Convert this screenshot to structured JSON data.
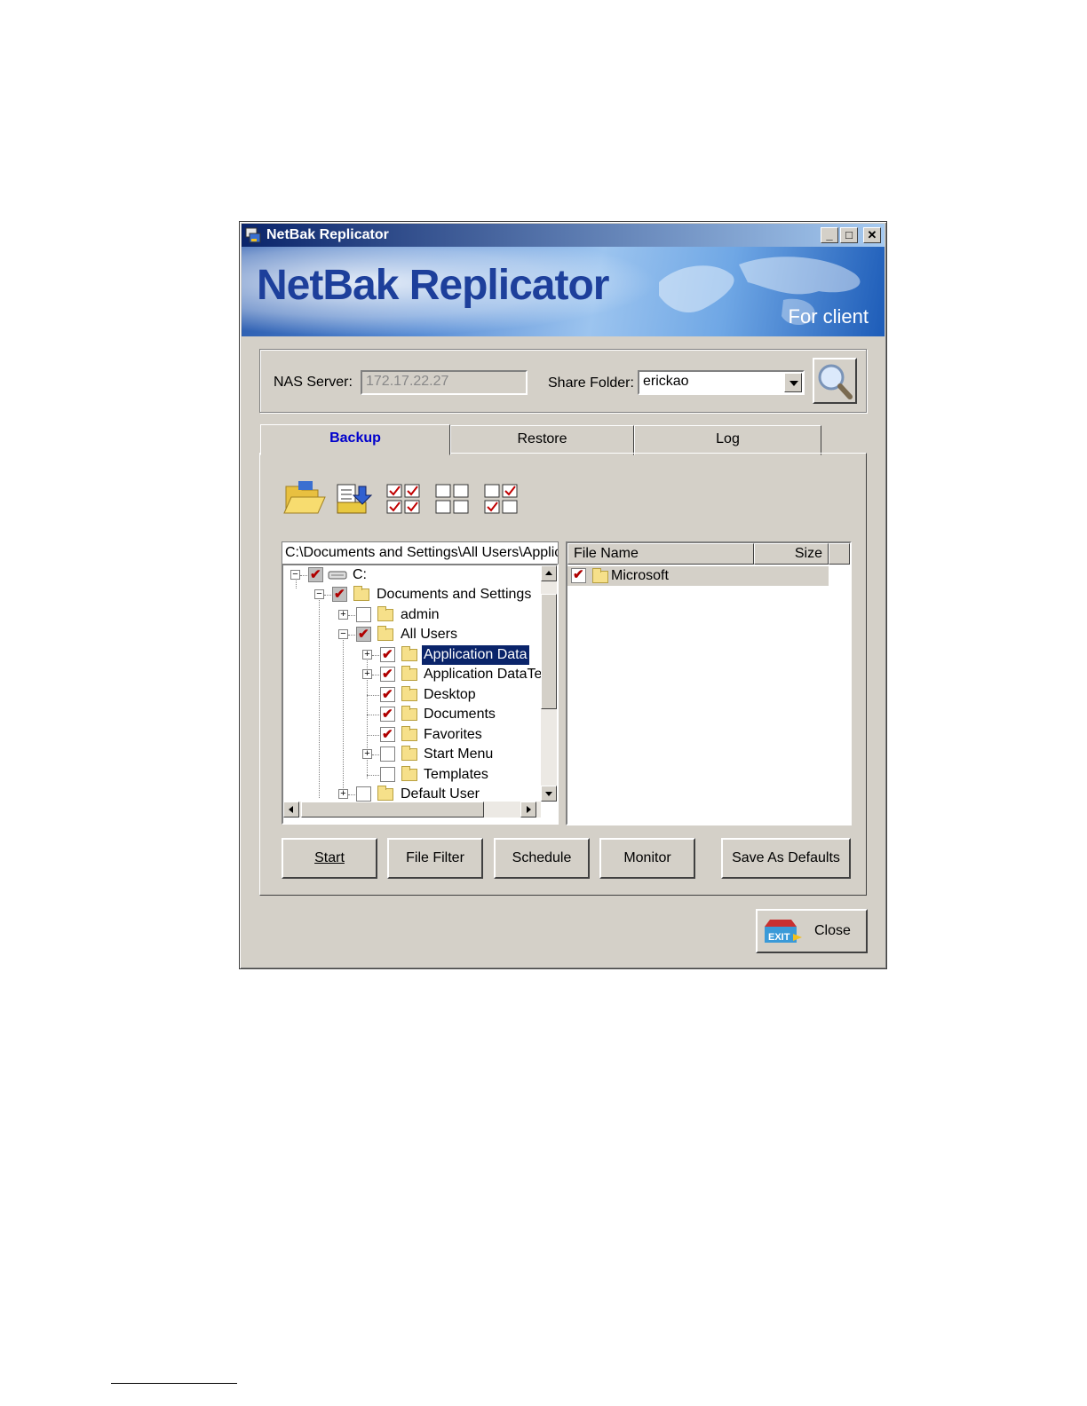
{
  "window": {
    "title": "NetBak Replicator",
    "controls": [
      "minimize",
      "maximize",
      "close"
    ]
  },
  "banner": {
    "logo_text": "NetBak Replicator",
    "subtitle": "For client"
  },
  "connection": {
    "nas_server_label": "NAS Server:",
    "nas_server_value": "172.17.22.27",
    "share_folder_label": "Share Folder:",
    "share_folder_value": "erickao"
  },
  "tabs": [
    {
      "label": "Backup",
      "active": true
    },
    {
      "label": "Restore",
      "active": false
    },
    {
      "label": "Log",
      "active": false
    }
  ],
  "toolbar": {
    "icons": [
      "open-folder-icon",
      "backup-files-icon",
      "select-all-icon",
      "unselect-all-icon",
      "invert-selection-icon"
    ]
  },
  "tree": {
    "path": "C:\\Documents and Settings\\All Users\\Applica",
    "nodes": [
      {
        "label": "C:",
        "checked": true,
        "partial": true,
        "expander": "minus"
      },
      {
        "label": "Documents and Settings",
        "checked": true,
        "partial": true,
        "expander": "minus"
      },
      {
        "label": "admin",
        "checked": false,
        "partial": false,
        "expander": "plus"
      },
      {
        "label": "All Users",
        "checked": true,
        "partial": true,
        "expander": "minus"
      },
      {
        "label": "Application Data",
        "checked": true,
        "partial": false,
        "expander": "plus",
        "selected": true
      },
      {
        "label": "Application DataTe",
        "checked": true,
        "partial": false,
        "expander": "plus"
      },
      {
        "label": "Desktop",
        "checked": true,
        "partial": false,
        "expander": "none"
      },
      {
        "label": "Documents",
        "checked": true,
        "partial": false,
        "expander": "none"
      },
      {
        "label": "Favorites",
        "checked": true,
        "partial": false,
        "expander": "none"
      },
      {
        "label": "Start Menu",
        "checked": false,
        "partial": false,
        "expander": "plus"
      },
      {
        "label": "Templates",
        "checked": false,
        "partial": false,
        "expander": "none"
      },
      {
        "label": "Default User",
        "checked": false,
        "partial": false,
        "expander": "plus"
      }
    ]
  },
  "file_list": {
    "columns": [
      "File Name",
      "Size"
    ],
    "rows": [
      {
        "name": "Microsoft",
        "checked": true
      }
    ]
  },
  "buttons": {
    "start": "Start",
    "file_filter": "File Filter",
    "schedule": "Schedule",
    "monitor": "Monitor",
    "save_as_defaults": "Save As Defaults",
    "close": "Close"
  },
  "colors": {
    "title_bar": "#0a246a",
    "face": "#d4d0c8",
    "active_tab_text": "#0000cc",
    "check_mark": "#b00000",
    "selection": "#0a246a"
  }
}
